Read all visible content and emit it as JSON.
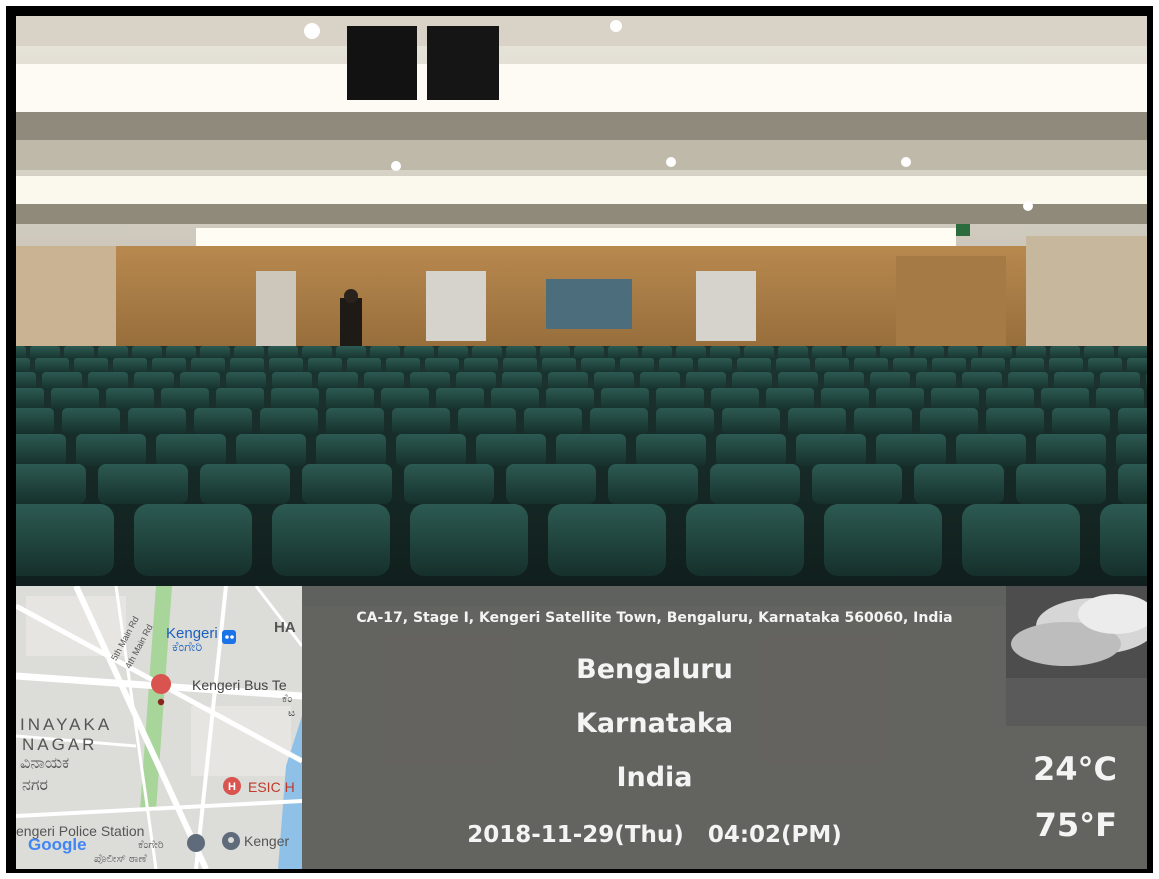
{
  "location": {
    "address": "CA-17, Stage I, Kengeri Satellite Town, Bengaluru, Karnataka 560060, India",
    "city": "Bengaluru",
    "state": "Karnataka",
    "country": "India",
    "date": "2018-11-29(Thu)",
    "time": "04:02(PM)"
  },
  "weather": {
    "temp_c": "24°C",
    "temp_f": "75°F",
    "icon": "cloudy-sky-icon"
  },
  "map": {
    "labels": {
      "kengeri": "Kengeri",
      "kengeri_kn": "ಕೆಂಗೇರಿ",
      "ha": "HA",
      "fifth_main": "5th Main Rd",
      "fourth_main": "4th Main Rd",
      "bus_terminal": "Kengeri Bus Te",
      "bus_terminal_kn": "ಕೆಂ",
      "bus_terminal_kn2": "ಟ",
      "vinayaka": "INAYAKA",
      "nagar": "NAGAR",
      "vinayaka_kn": "ವಿನಾಯಕ",
      "nagara_kn": "ನಗರ",
      "esic": "ESIC H",
      "police": "engeri Police Station",
      "police_kn": "ಕೆಂಗೇರಿ",
      "police_kn2": "ಪೊಲೀಸ್ ಠಾಣೆ",
      "kenger": "Kenger",
      "google": "Google"
    },
    "colors": {
      "background": "#dcdcd9",
      "road": "#ffffff",
      "park": "#a8d59a",
      "water": "#8fc1e8",
      "pin": "#d9534f",
      "transit": "#1a73e8"
    }
  }
}
